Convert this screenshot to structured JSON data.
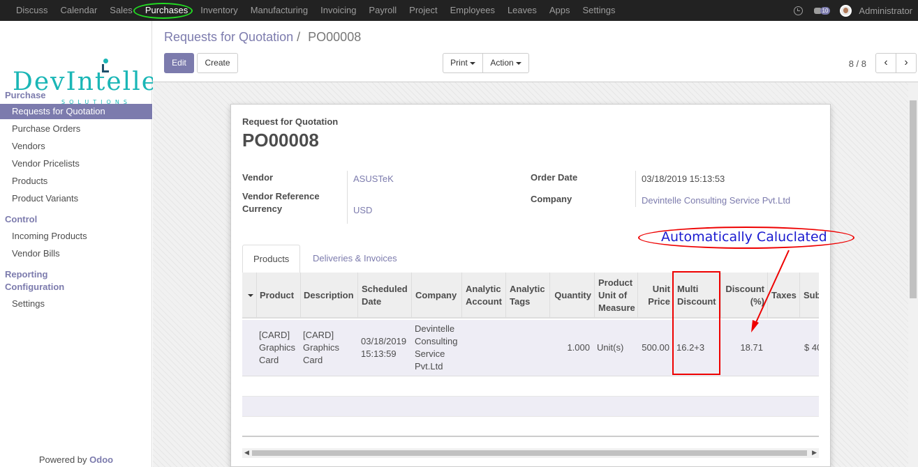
{
  "topbar": {
    "menu": [
      "Discuss",
      "Calendar",
      "Sales",
      "Purchases",
      "Inventory",
      "Manufacturing",
      "Invoicing",
      "Payroll",
      "Project",
      "Employees",
      "Leaves",
      "Apps",
      "Settings"
    ],
    "active": "Purchases",
    "chat_count": "10",
    "user": "Administrator"
  },
  "sidebar": {
    "logo_word": "DevIntelle",
    "logo_sub": "SOLUTIONS",
    "sections": {
      "purchase": "Purchase",
      "control": "Control",
      "reporting": "Reporting",
      "configuration": "Configuration"
    },
    "items": {
      "rfq": "Requests for Quotation",
      "purchase_orders": "Purchase Orders",
      "vendors": "Vendors",
      "vendor_pricelists": "Vendor Pricelists",
      "products": "Products",
      "product_variants": "Product Variants",
      "incoming_products": "Incoming Products",
      "vendor_bills": "Vendor Bills",
      "settings": "Settings"
    },
    "powered_by": "Powered by",
    "powered_brand": "Odoo"
  },
  "control_panel": {
    "breadcrumb_parent": "Requests for Quotation",
    "breadcrumb_sep": "/",
    "breadcrumb_current": "PO00008",
    "edit": "Edit",
    "create": "Create",
    "print": "Print",
    "action": "Action",
    "pager": "8 / 8"
  },
  "form": {
    "doc_type": "Request for Quotation",
    "name": "PO00008",
    "vendor_label": "Vendor",
    "vendor": "ASUSTeK",
    "vendor_ref_label": "Vendor Reference",
    "currency_label": "Currency",
    "currency": "USD",
    "order_date_label": "Order Date",
    "order_date": "03/18/2019 15:13:53",
    "company_label": "Company",
    "company": "Devintelle Consulting Service Pvt.Ltd"
  },
  "tabs": [
    "Products",
    "Deliveries & Invoices"
  ],
  "table": {
    "headers": {
      "product": "Product",
      "description": "Description",
      "scheduled_date_1": "Scheduled",
      "scheduled_date_2": "Date",
      "company": "Company",
      "analytic_account_1": "Analytic",
      "analytic_account_2": "Account",
      "analytic_tags_1": "Analytic",
      "analytic_tags_2": "Tags",
      "quantity": "Quantity",
      "uom_1": "Product",
      "uom_2": "Unit of",
      "uom_3": "Measure",
      "unit_price_1": "Unit",
      "unit_price_2": "Price",
      "multi_discount_1": "Multi",
      "multi_discount_2": "Discount",
      "discount_1": "Discount",
      "discount_2": "(%)",
      "taxes": "Taxes",
      "subtotal": "Sub"
    },
    "row": {
      "product_1": "[CARD]",
      "product_2": "Graphics",
      "product_3": "Card",
      "description_1": "[CARD]",
      "description_2": "Graphics",
      "description_3": "Card",
      "scheduled_1": "03/18/2019",
      "scheduled_2": "15:13:59",
      "company_1": "Devintelle",
      "company_2": "Consulting",
      "company_3": "Service",
      "company_4": "Pvt.Ltd",
      "quantity": "1.000",
      "uom": "Unit(s)",
      "unit_price": "500.00",
      "multi_discount": "16.2+3",
      "discount": "18.71",
      "subtotal": "$ 40"
    }
  },
  "annotation": {
    "text": "Automatically Caluclated",
    "color": "#e00000"
  },
  "colors": {
    "brand": "#7c7bad",
    "topbar": "#222222"
  }
}
